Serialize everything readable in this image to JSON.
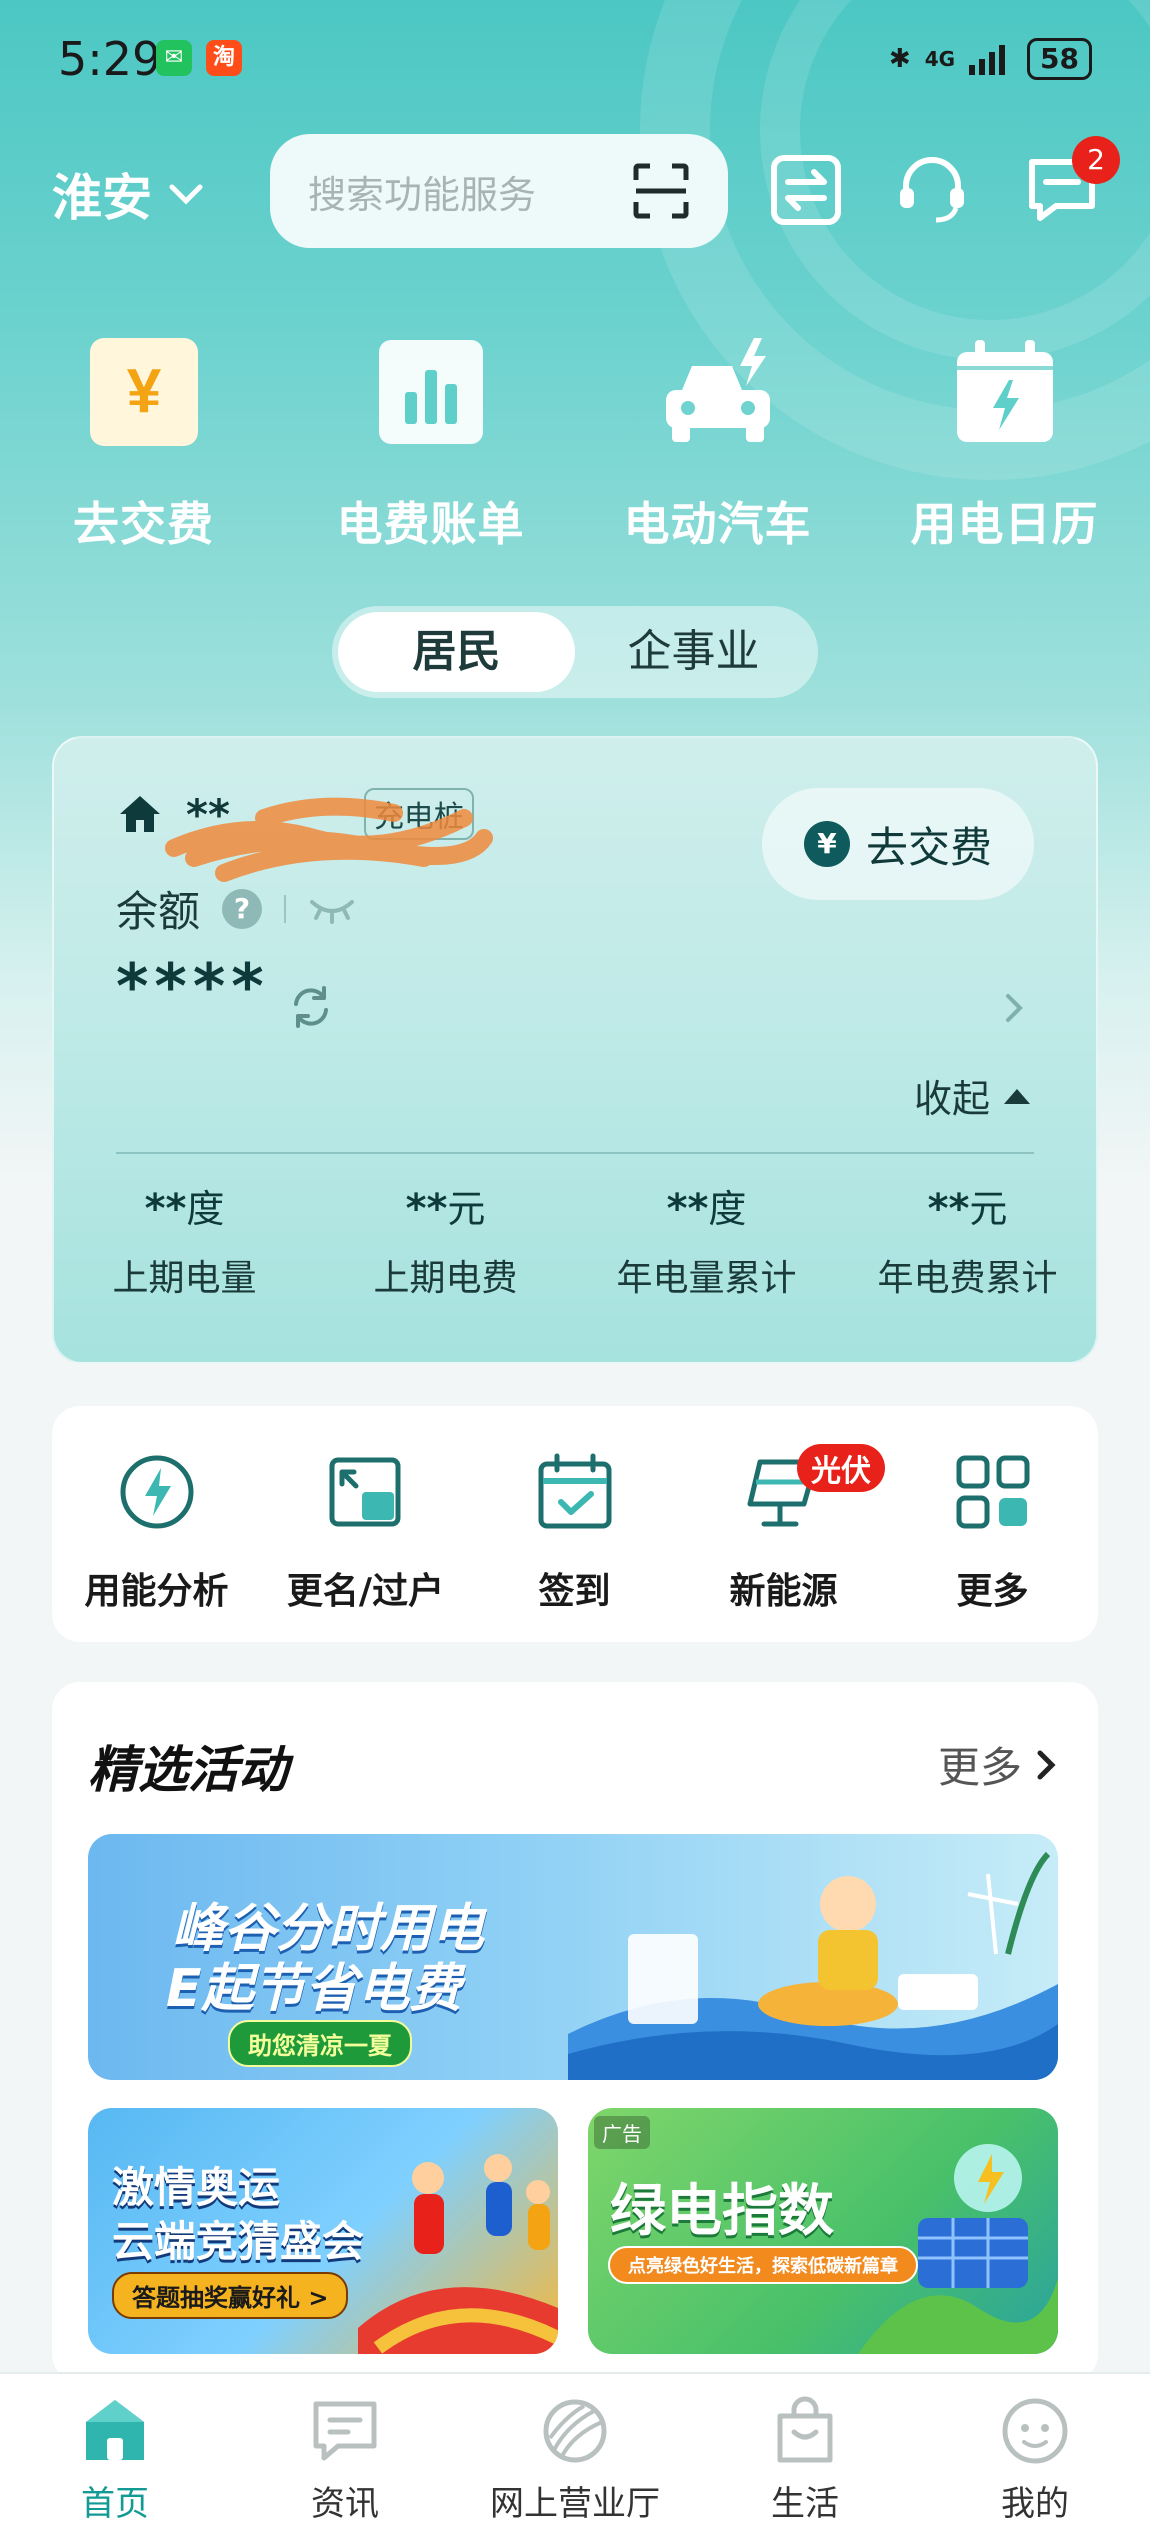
{
  "status_bar": {
    "time": "5:29",
    "network": "4G",
    "battery": "58"
  },
  "header": {
    "city": "淮安",
    "search_placeholder": "搜索功能服务",
    "message_badge": "2"
  },
  "quick_actions": [
    {
      "label": "去交费",
      "icon": "yuan-icon"
    },
    {
      "label": "电费账单",
      "icon": "bar-chart-icon"
    },
    {
      "label": "电动汽车",
      "icon": "ev-car-icon"
    },
    {
      "label": "用电日历",
      "icon": "calendar-icon"
    }
  ],
  "segments": {
    "active": "居民",
    "inactive": "企事业"
  },
  "account": {
    "name": "**",
    "tag": "充电桩",
    "pay_button": "去交费",
    "balance_label": "余额",
    "balance_value": "****",
    "collapse_label": "收起",
    "stats": [
      {
        "value": "**",
        "unit": "度",
        "label": "上期电量"
      },
      {
        "value": "**",
        "unit": "元",
        "label": "上期电费"
      },
      {
        "value": "**",
        "unit": "度",
        "label": "年电量累计"
      },
      {
        "value": "**",
        "unit": "元",
        "label": "年电费累计"
      }
    ]
  },
  "services": [
    {
      "label": "用能分析",
      "icon": "energy-analysis-icon"
    },
    {
      "label": "更名/过户",
      "icon": "transfer-icon"
    },
    {
      "label": "签到",
      "icon": "check-in-icon"
    },
    {
      "label": "新能源",
      "icon": "solar-panel-icon",
      "badge": "光伏"
    },
    {
      "label": "更多",
      "icon": "grid-icon"
    }
  ],
  "activities": {
    "title": "精选活动",
    "more": "更多",
    "banner_main": {
      "title_line1": "峰谷分时用电",
      "title_line2": "E起节省电费",
      "pill": "助您清凉一夏"
    },
    "banner_left": {
      "title_line1": "激情奥运",
      "title_line2": "云端竞猜盛会",
      "pill": "答题抽奖赢好礼 >"
    },
    "banner_right": {
      "ad": "广告",
      "title": "绿电指数",
      "pill": "点亮绿色好生活，探索低碳新篇章"
    }
  },
  "bottom_nav": [
    {
      "label": "首页",
      "icon": "home-icon",
      "active": true
    },
    {
      "label": "资讯",
      "icon": "news-icon"
    },
    {
      "label": "网上营业厅",
      "icon": "globe-icon"
    },
    {
      "label": "生活",
      "icon": "shopping-bag-icon"
    },
    {
      "label": "我的",
      "icon": "profile-icon"
    }
  ],
  "colors": {
    "brand": "#129a95",
    "badge_red": "#e8221b"
  }
}
